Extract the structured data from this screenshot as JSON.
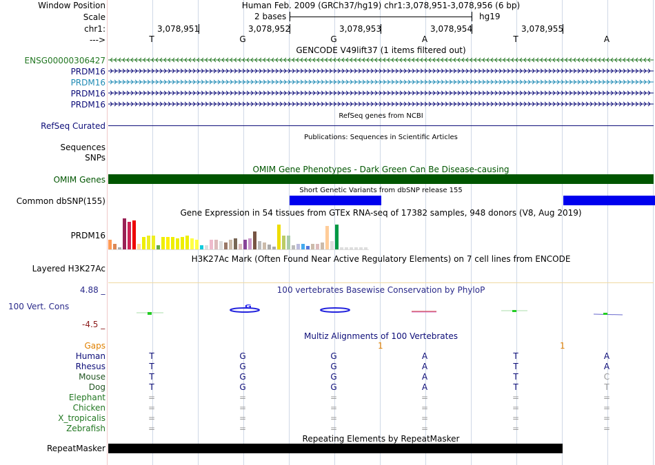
{
  "header": {
    "window_label": "Window Position",
    "window_value": "Human Feb. 2009 (GRCh37/hg19)   chr1:3,078,951-3,078,956 (6 bp)",
    "scale_label": "Scale",
    "scale_text": "2 bases",
    "scale_assembly": "hg19",
    "chrom_label": "chr1:",
    "arrow_label": "--->",
    "positions": [
      "3,078,951",
      "3,078,952",
      "3,078,953",
      "3,078,954",
      "3,078,955"
    ]
  },
  "bases": [
    "T",
    "G",
    "G",
    "A",
    "T",
    "A"
  ],
  "tracks": {
    "gencode": {
      "title": "GENCODE V49lift37 (1 items filtered out)",
      "items": [
        {
          "name": "ENSG00000306427",
          "color": "#227722",
          "dir": "<"
        },
        {
          "name": "PRDM16",
          "color": "#0c0c78",
          "dir": ">"
        },
        {
          "name": "PRDM16",
          "color": "#1e8ab4",
          "dir": ">"
        },
        {
          "name": "PRDM16",
          "color": "#0c0c78",
          "dir": ">"
        },
        {
          "name": "PRDM16",
          "color": "#0c0c78",
          "dir": ">"
        }
      ]
    },
    "refseq": {
      "title": "RefSeq genes from NCBI",
      "label": "RefSeq Curated"
    },
    "publications": {
      "title": "Publications: Sequences in Scientific Articles",
      "label": "Sequences"
    },
    "snps_label": "SNPs",
    "omim": {
      "title": "OMIM Gene Phenotypes - Dark Green Can Be Disease-causing",
      "label": "OMIM Genes",
      "color": "#005500"
    },
    "dbsnp": {
      "title": "Short Genetic Variants from dbSNP release 155",
      "label": "Common dbSNP(155)",
      "color": "#0000ee"
    },
    "gtex": {
      "title": "Gene Expression in 54 tissues from GTEx RNA-seq of 17382 samples, 948 donors (V8, Aug 2019)",
      "label": "PRDM16",
      "values": [
        14,
        8,
        3,
        45,
        40,
        42,
        8,
        18,
        20,
        20,
        6,
        18,
        18,
        18,
        16,
        18,
        20,
        16,
        14,
        6,
        6,
        14,
        14,
        12,
        10,
        14,
        16,
        8,
        14,
        16,
        26,
        12,
        10,
        7,
        4,
        36,
        20,
        20,
        6,
        8,
        8,
        5,
        8,
        8,
        10,
        34,
        12,
        36,
        3,
        3,
        3,
        3,
        3,
        3
      ],
      "colors": [
        "#ff9a55",
        "#dd8855",
        "#aaaaaa",
        "#992255",
        "#cc2255",
        "#ee0000",
        "#ffdd99",
        "#eeee00",
        "#eeee22",
        "#eeee22",
        "#66aa44",
        "#eeee00",
        "#ffee00",
        "#eeee00",
        "#eeee00",
        "#eeee00",
        "#eeee00",
        "#ffff44",
        "#ffff44",
        "#11ccdd",
        "#dddddd",
        "#eebbcc",
        "#ddbbbb",
        "#dddddd",
        "#997766",
        "#ccbbaa",
        "#776655",
        "#ddbbbb",
        "#884499",
        "#cc99cc",
        "#775544",
        "#bbbbbb",
        "#ccbbaa",
        "#aaaaaa",
        "#aaaaaa",
        "#eedd00",
        "#bbcc66",
        "#aaccaa",
        "#bbbbbb",
        "#bbbbdd",
        "#44aaee",
        "#5577dd",
        "#ccbbaa",
        "#ddbbbb",
        "#ccbbaa",
        "#ffcc99",
        "#dddddd",
        "#009944",
        "#dddddd",
        "#dddddd",
        "#dddddd",
        "#dddddd",
        "#dddddd",
        "#dddddd"
      ]
    },
    "h3k27ac": {
      "title": "H3K27Ac Mark (Often Found Near Active Regulatory Elements) on 7 cell lines from ENCODE",
      "label": "Layered H3K27Ac"
    },
    "phylop": {
      "title": "100 vertebrates Basewise Conservation by PhyloP",
      "label": "100 Vert. Cons",
      "max": "4.88 _",
      "min": "-4.5 _"
    },
    "multiz": {
      "title": "Multiz Alignments of 100 Vertebrates",
      "gaps_label": "Gaps",
      "gap_marks": [
        "1",
        "1"
      ],
      "species": [
        {
          "name": "Human",
          "seq": [
            "T",
            "G",
            "G",
            "A",
            "T",
            "A"
          ]
        },
        {
          "name": "Rhesus",
          "seq": [
            "T",
            "G",
            "G",
            "A",
            "T",
            "A"
          ]
        },
        {
          "name": "Mouse",
          "seq": [
            "T",
            "G",
            "G",
            "A",
            "T",
            "C"
          ]
        },
        {
          "name": "Dog",
          "seq": [
            "T",
            "G",
            "G",
            "A",
            "T",
            "T"
          ]
        },
        {
          "name": "Elephant",
          "seq": [
            "=",
            "=",
            "=",
            "=",
            "=",
            "="
          ]
        },
        {
          "name": "Chicken",
          "seq": [
            "=",
            "=",
            "=",
            "=",
            "=",
            "="
          ]
        },
        {
          "name": "X_tropicalis",
          "seq": [
            "=",
            "=",
            "=",
            "=",
            "=",
            "="
          ]
        },
        {
          "name": "Zebrafish",
          "seq": [
            "=",
            "=",
            "=",
            "=",
            "=",
            "="
          ]
        }
      ]
    },
    "repeatmasker": {
      "title": "Repeating Elements by RepeatMasker",
      "label": "RepeatMasker"
    }
  }
}
